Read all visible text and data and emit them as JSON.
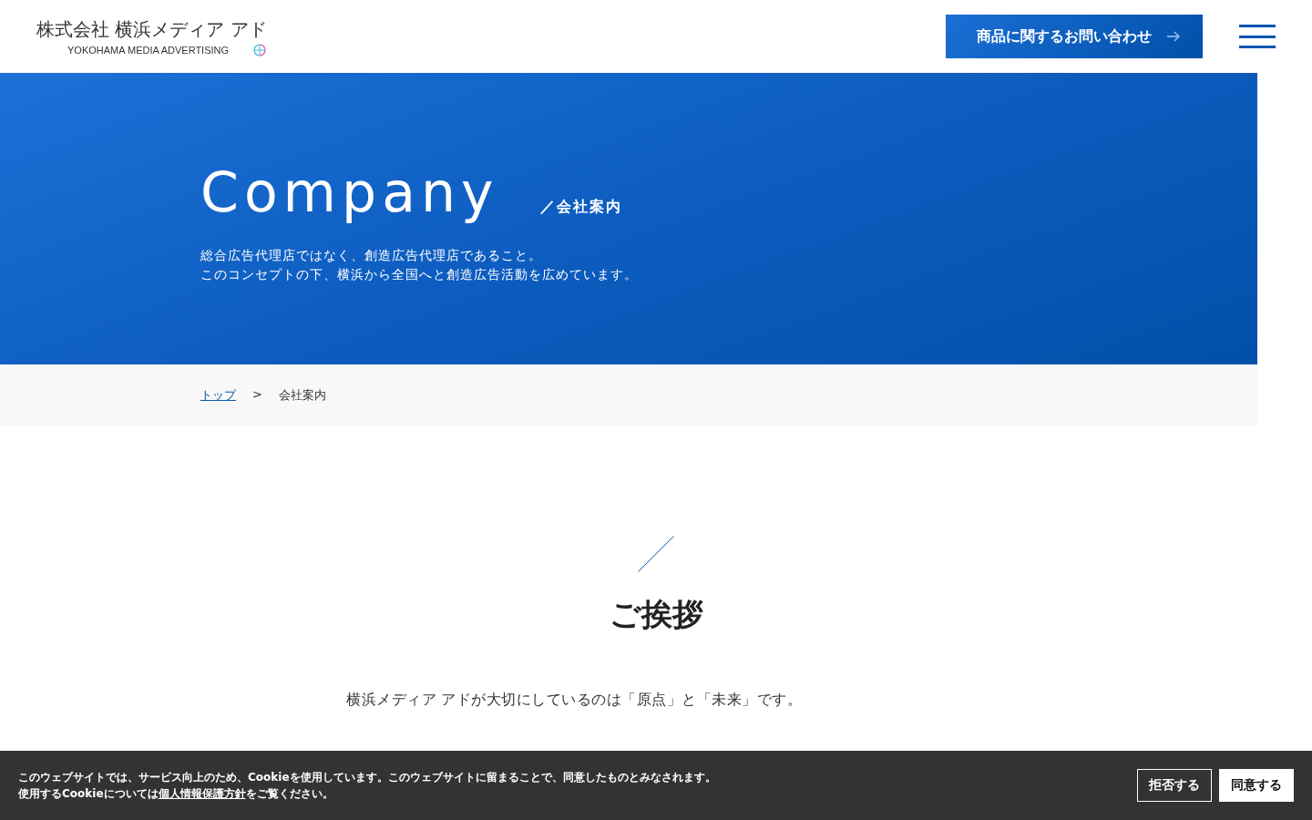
{
  "header": {
    "logo": {
      "name": "株式会社 横浜メディア アド",
      "subtitle": "YOKOHAMA MEDIA ADVERTISING"
    },
    "contact_button": "商品に関するお問い合わせ"
  },
  "hero": {
    "title": "Company",
    "subtitle": "／会社案内",
    "lead": [
      "総合広告代理店ではなく、創造広告代理店であること。",
      "このコンセプトの下、横浜から全国へと創造広告活動を広めています。"
    ]
  },
  "breadcrumb": [
    {
      "label": "トップ",
      "kind": "link"
    },
    {
      "label": ">",
      "kind": "separator"
    },
    {
      "label": "会社案内",
      "kind": "current"
    }
  ],
  "section": {
    "heading": "ご挨拶",
    "paragraphs": [
      "横浜メディア アドが大切にしているのは「原点」と「未来」です。"
    ]
  },
  "cookie_banner": {
    "line1": "このウェブサイトでは、サービス向上のため、Cookieを使用しています。このウェブサイトに留まることで、同意したものとみなされます。",
    "line2_before": "使用するCookieについては",
    "link": "個人情報保護方針",
    "line2_after": "をご覧ください。",
    "buttons": [
      {
        "label": "拒否する",
        "kind": "reject"
      },
      {
        "label": "同意する",
        "kind": "accept"
      }
    ]
  }
}
